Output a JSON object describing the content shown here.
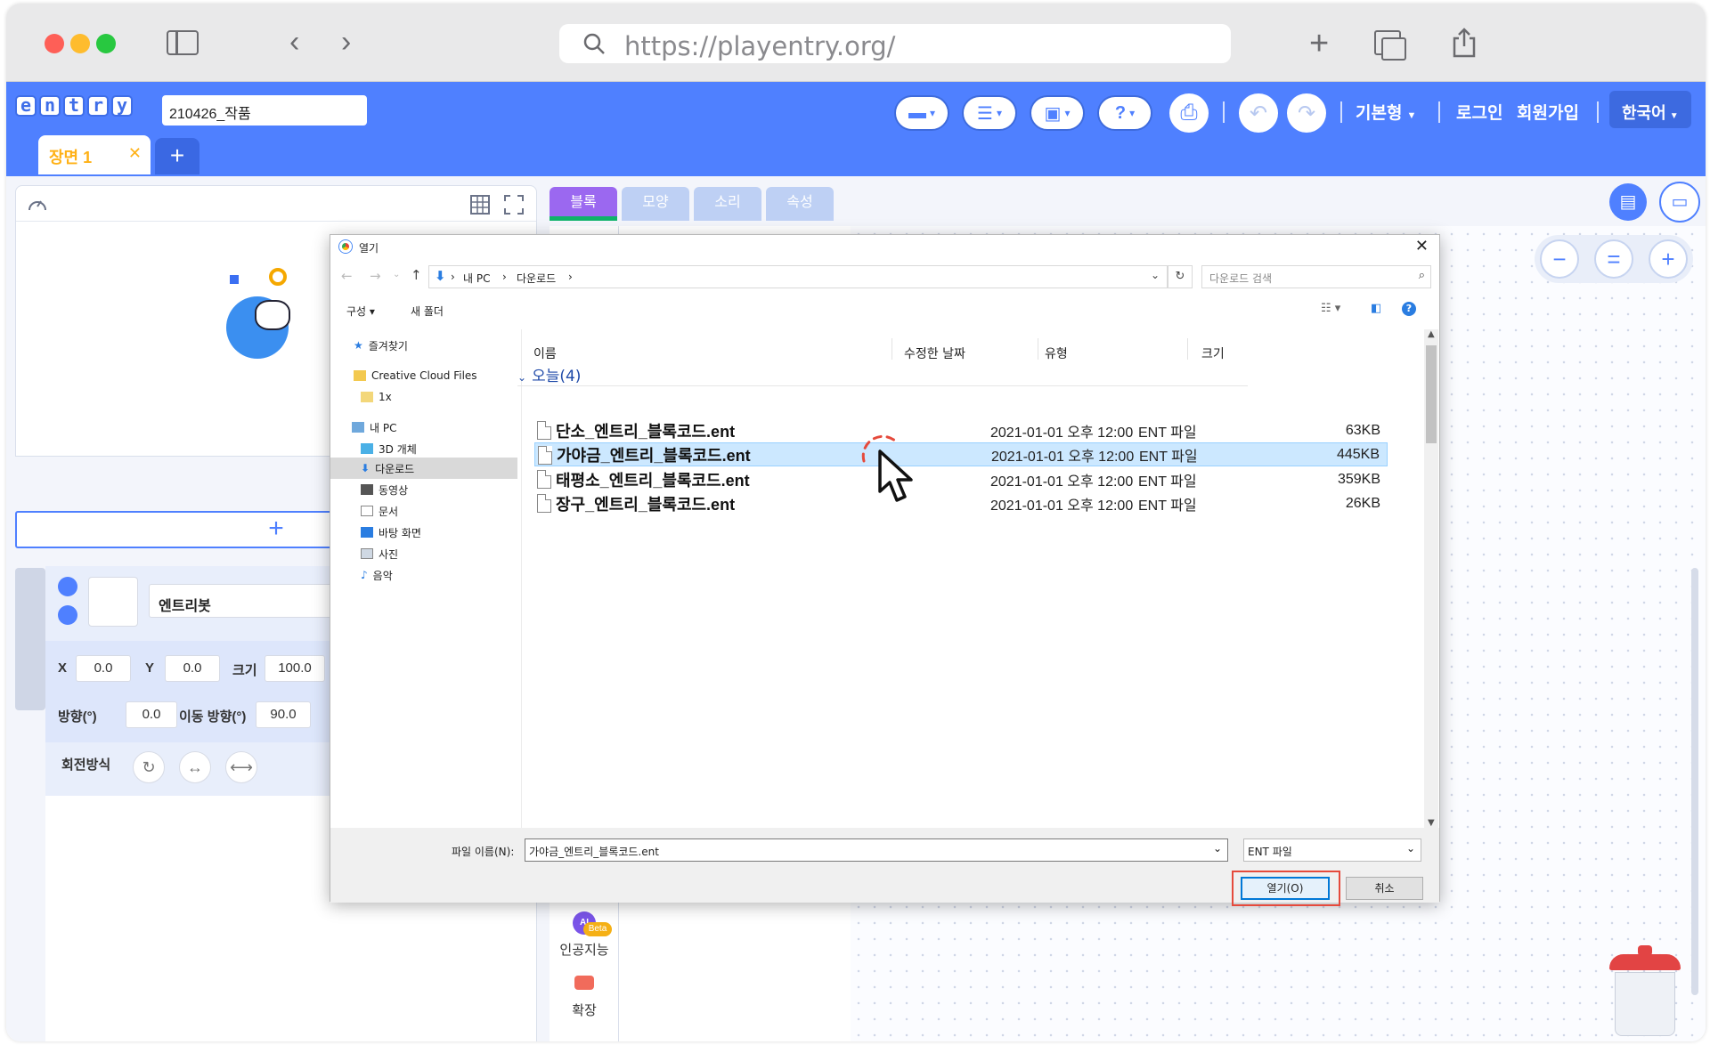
{
  "browser": {
    "url": "https://playentry.org/"
  },
  "entry_header": {
    "logo_letters": [
      "e",
      "n",
      "t",
      "r",
      "y"
    ],
    "project_name": "210426_작품",
    "mode_label": "기본형",
    "login_label": "로그인",
    "signup_label": "회원가입",
    "language_label": "한국어",
    "scene_tab": "장면 1",
    "scene_close": "✕",
    "scene_add": "+"
  },
  "block_tabs": [
    {
      "label": "블록",
      "active": true
    },
    {
      "label": "모양",
      "active": false
    },
    {
      "label": "소리",
      "active": false
    },
    {
      "label": "속성",
      "active": false
    }
  ],
  "object": {
    "name": "엔트리봇",
    "x_label": "X",
    "x_value": "0.0",
    "y_label": "Y",
    "y_value": "0.0",
    "size_label": "크기",
    "size_value": "100.0",
    "direction_label": "방향(°)",
    "direction_value": "0.0",
    "move_direction_label": "이동 방향(°)",
    "move_direction_value": "90.0",
    "rotation_label": "회전방식"
  },
  "categories": {
    "ai_label": "인공지능",
    "ai_badge": "Beta",
    "ai_letters": "AI",
    "ext_label": "확장"
  },
  "zoom": {
    "minus": "−",
    "reset": "=",
    "plus": "+"
  },
  "dialog": {
    "title": "열기",
    "path": [
      "내 PC",
      "다운로드"
    ],
    "search_placeholder": "다운로드 검색",
    "organize_label": "구성",
    "new_folder_label": "새 폴더",
    "nav": {
      "favorites": "즐겨찾기",
      "creative_cloud": "Creative Cloud Files",
      "folder_1x": "1x",
      "my_pc": "내 PC",
      "objects_3d": "3D 개체",
      "downloads": "다운로드",
      "videos": "동영상",
      "documents": "문서",
      "desktop": "바탕 화면",
      "pictures": "사진",
      "music": "음악"
    },
    "columns": {
      "name": "이름",
      "modified": "수정한 날짜",
      "type": "유형",
      "size": "크기"
    },
    "group_label": "오늘(4)",
    "files": [
      {
        "name": "단소_엔트리_블록코드.ent",
        "modified": "2021-01-01  오후  12:00",
        "type": "ENT 파일",
        "size": "63KB"
      },
      {
        "name": "가야금_엔트리_블록코드.ent",
        "modified": "2021-01-01  오후  12:00",
        "type": "ENT 파일",
        "size": "445KB"
      },
      {
        "name": "태평소_엔트리_블록코드.ent",
        "modified": "2021-01-01  오후  12:00",
        "type": "ENT 파일",
        "size": "359KB"
      },
      {
        "name": "장구_엔트리_블록코드.ent",
        "modified": "2021-01-01  오후  12:00",
        "type": "ENT 파일",
        "size": "26KB"
      }
    ],
    "filename_label": "파일 이름(N):",
    "filename_value": "가야금_엔트리_블록코드.ent",
    "filetype_value": "ENT 파일",
    "open_button": "열기(O)",
    "cancel_button": "취소"
  },
  "colors": {
    "entry_blue": "#4f80ff",
    "block_tab_purple": "#9b68f0",
    "highlight_red": "#e54a3c",
    "selection_blue": "#cce8ff"
  }
}
